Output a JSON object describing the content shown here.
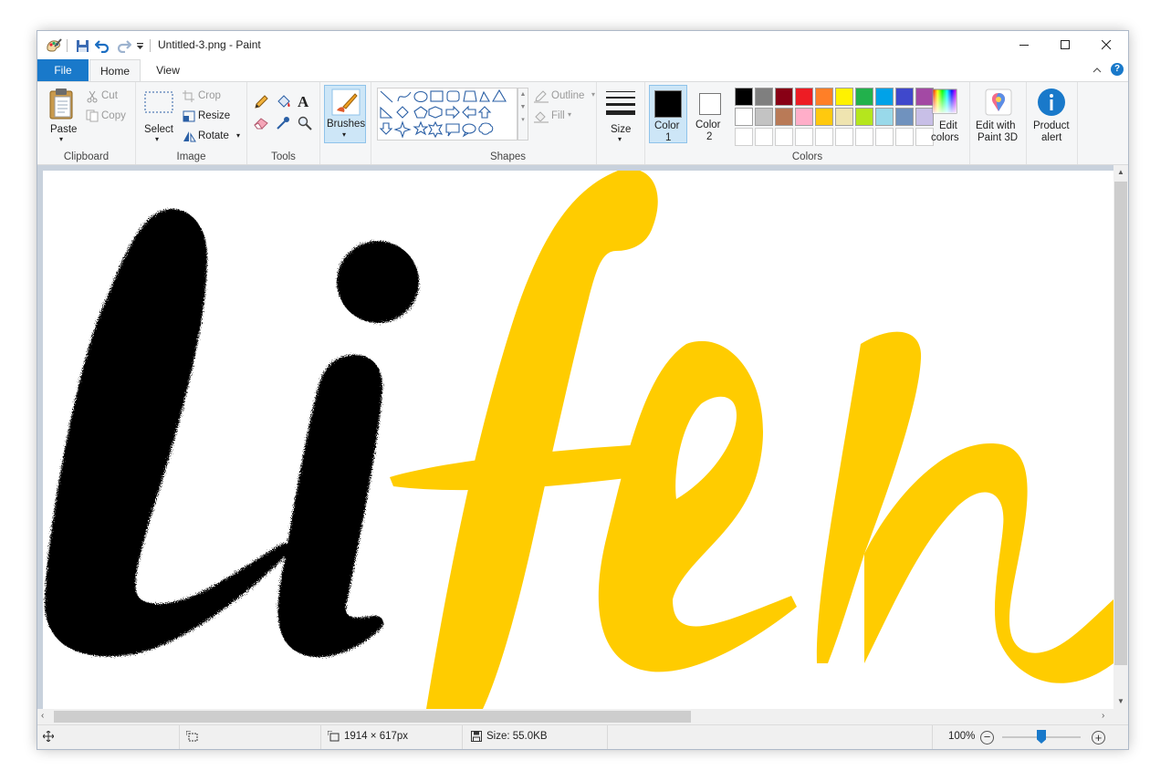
{
  "window": {
    "title": "Untitled-3.png - Paint"
  },
  "tabs": {
    "file": "File",
    "home": "Home",
    "view": "View"
  },
  "clipboard": {
    "paste": "Paste",
    "cut": "Cut",
    "copy": "Copy",
    "group": "Clipboard"
  },
  "image": {
    "select": "Select",
    "crop": "Crop",
    "resize": "Resize",
    "rotate": "Rotate",
    "group": "Image"
  },
  "tools": {
    "group": "Tools"
  },
  "brushes": {
    "label": "Brushes"
  },
  "shapes": {
    "outline": "Outline",
    "fill": "Fill",
    "group": "Shapes"
  },
  "size": {
    "label": "Size"
  },
  "colors": {
    "color1_line1": "Color",
    "color1_line2": "1",
    "color2_line1": "Color",
    "color2_line2": "2",
    "edit_line1": "Edit",
    "edit_line2": "colors",
    "group": "Colors",
    "color1": "#000000",
    "color2": "#ffffff",
    "palette_row1": [
      "#000000",
      "#7f7f7f",
      "#880015",
      "#ed1c24",
      "#ff7f27",
      "#fff200",
      "#22b14c",
      "#00a2e8",
      "#3f48cc",
      "#a349a4"
    ],
    "palette_row2": [
      "#ffffff",
      "#c3c3c3",
      "#b97a57",
      "#ffaec9",
      "#ffc90e",
      "#efe4b0",
      "#b5e61d",
      "#99d9ea",
      "#7092be",
      "#c8bfe7"
    ]
  },
  "paint3d": {
    "line1": "Edit with",
    "line2": "Paint 3D"
  },
  "product_alert": {
    "line1": "Product",
    "line2": "alert"
  },
  "canvas": {
    "drawn_text": "lifew",
    "accent": "#ffcc00",
    "ink": "#000000"
  },
  "status": {
    "dimensions": "1914 × 617px",
    "size": "Size: 55.0KB",
    "zoom": "100%",
    "zoom_level": 0.5
  }
}
